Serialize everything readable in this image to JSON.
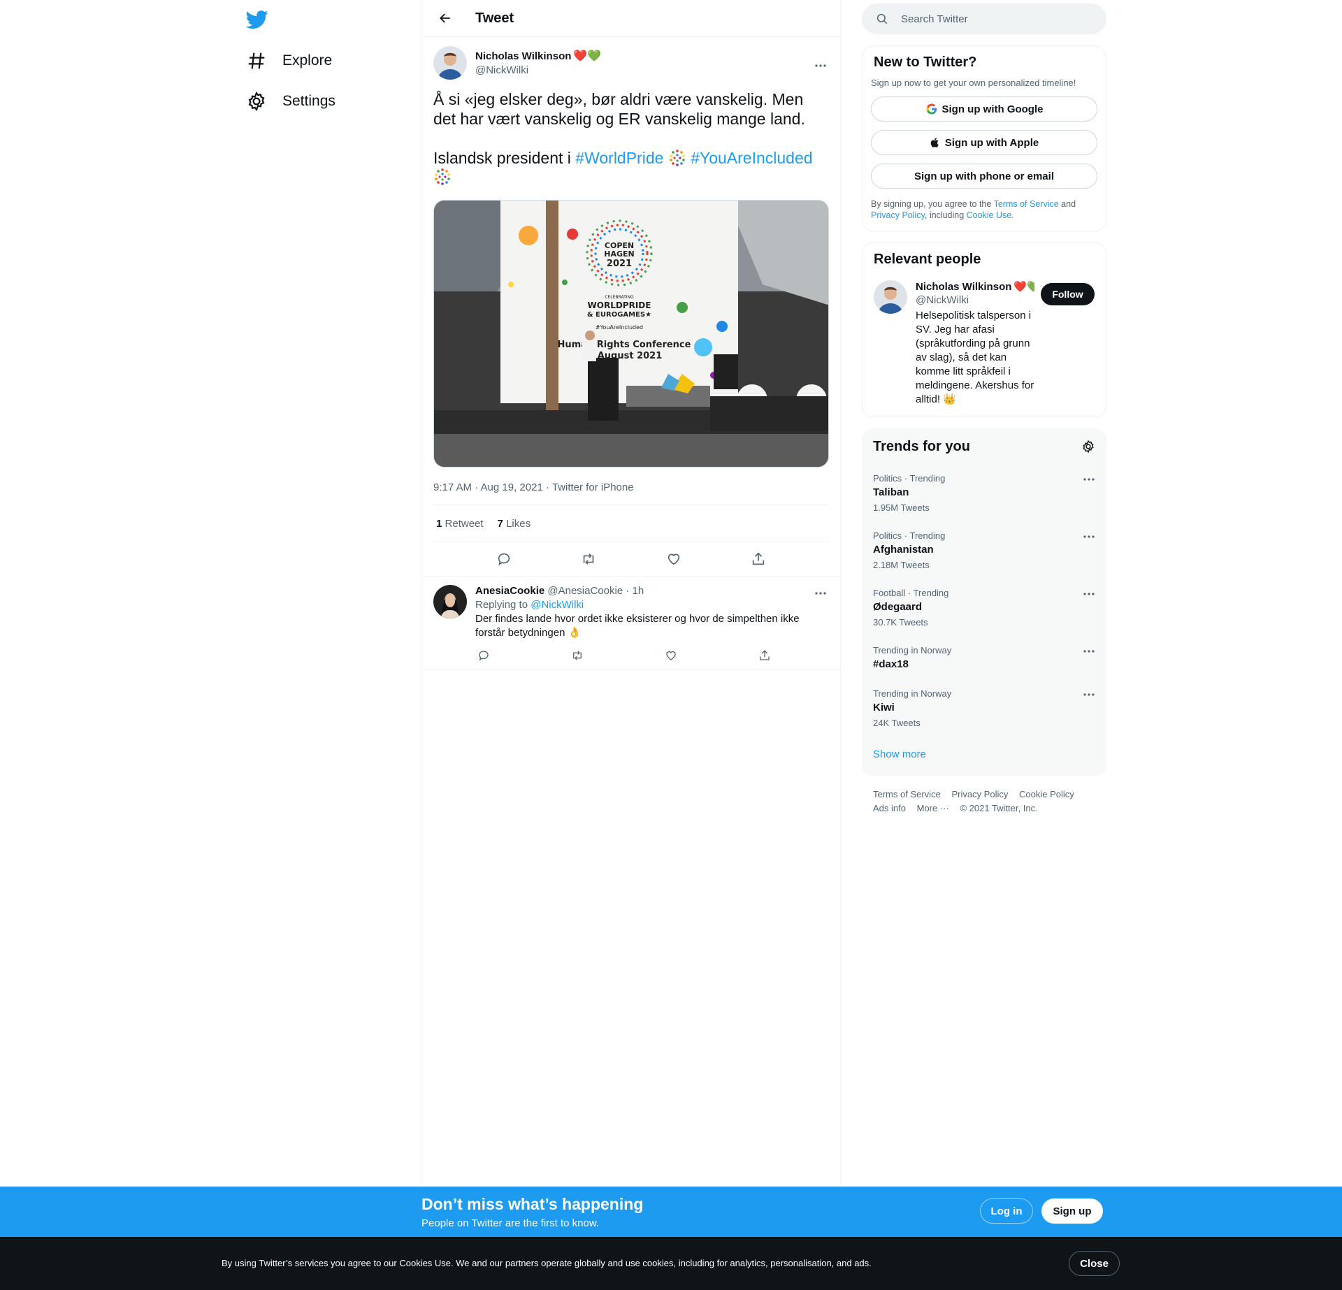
{
  "colors": {
    "accent": "#1d9bf0",
    "text": "#0f1419",
    "muted": "#536471",
    "border": "#eff3f4"
  },
  "nav": {
    "logo_icon": "bird-icon",
    "items": [
      {
        "label": "Explore",
        "icon": "hashtag-icon"
      },
      {
        "label": "Settings",
        "icon": "gear-icon"
      }
    ]
  },
  "header": {
    "title": "Tweet"
  },
  "tweet": {
    "author_name": "Nicholas Wilkinson",
    "author_emoji": "❤️💚",
    "handle": "@NickWilki",
    "text_line1": "Å si «jeg elsker deg», bør aldri være vanskelig. Men det har vært vanskelig og ER vanskelig mange land.",
    "text_line2_prefix": "Islandsk president i ",
    "hashtag1": "#WorldPride",
    "hashtag2": "#YouAreIncluded",
    "media_text": {
      "city1": "COPEN",
      "city2": "HAGEN",
      "year": "2021",
      "celebrating": "CELEBRATING",
      "event1": "WORLDPRIDE",
      "event2": "& EUROGAMES★",
      "hashtag": "#YouAreIncluded",
      "conf1": "Human Rights Conference",
      "conf2": "August 2021"
    },
    "time": "9:17 AM · Aug 19, 2021 · Twitter for iPhone",
    "retweets": "1",
    "retweets_label": "Retweet",
    "likes": "7",
    "likes_label": "Likes"
  },
  "reply": {
    "name": "AnesiaCookie",
    "handle_time": "@AnesiaCookie · 1h",
    "replying_to_label": "Replying to ",
    "replying_to": "@NickWilki",
    "text": "Der findes lande hvor ordet ikke eksisterer og hvor de simpelthen ikke forstår betydningen 👌"
  },
  "search": {
    "placeholder": "Search Twitter"
  },
  "new_to_twitter": {
    "title": "New to Twitter?",
    "subtitle": "Sign up now to get your own personalized timeline!",
    "google": "Sign up with Google",
    "apple": "Sign up with Apple",
    "phone": "Sign up with phone or email",
    "legal_1": "By signing up, you agree to the ",
    "terms": "Terms of Service",
    "legal_2": " and ",
    "privacy": "Privacy Policy",
    "legal_3": ", including ",
    "cookie": "Cookie Use."
  },
  "relevant": {
    "title": "Relevant people",
    "name": "Nicholas Wilkinson",
    "emoji": "❤️💚",
    "handle": "@NickWilki",
    "follow": "Follow",
    "bio": "Helsepolitisk talsperson i SV. Jeg har afasi (språkutfording på grunn av slag), så det kan komme litt språkfeil i meldingene. Akershus for alltid! 👑"
  },
  "trends": {
    "title": "Trends for you",
    "items": [
      {
        "category": "Politics · Trending",
        "name": "Taliban",
        "count": "1.95M Tweets"
      },
      {
        "category": "Politics · Trending",
        "name": "Afghanistan",
        "count": "2.18M Tweets"
      },
      {
        "category": "Football · Trending",
        "name": "Ødegaard",
        "count": "30.7K Tweets"
      },
      {
        "category": "Trending in Norway",
        "name": "#dax18",
        "count": ""
      },
      {
        "category": "Trending in Norway",
        "name": "Kiwi",
        "count": "24K Tweets"
      }
    ],
    "show_more": "Show more"
  },
  "footer": {
    "terms": "Terms of Service",
    "privacy": "Privacy Policy",
    "cookie": "Cookie Policy",
    "ads": "Ads info",
    "more": "More ···",
    "copyright": "© 2021 Twitter, Inc."
  },
  "signup_bar": {
    "title": "Don’t miss what’s happening",
    "subtitle": "People on Twitter are the first to know.",
    "login": "Log in",
    "signup": "Sign up"
  },
  "cookie_bar": {
    "text": "By using Twitter’s services you agree to our Cookies Use. We and our partners operate globally and use cookies, including for analytics, personalisation, and ads.",
    "close": "Close"
  }
}
